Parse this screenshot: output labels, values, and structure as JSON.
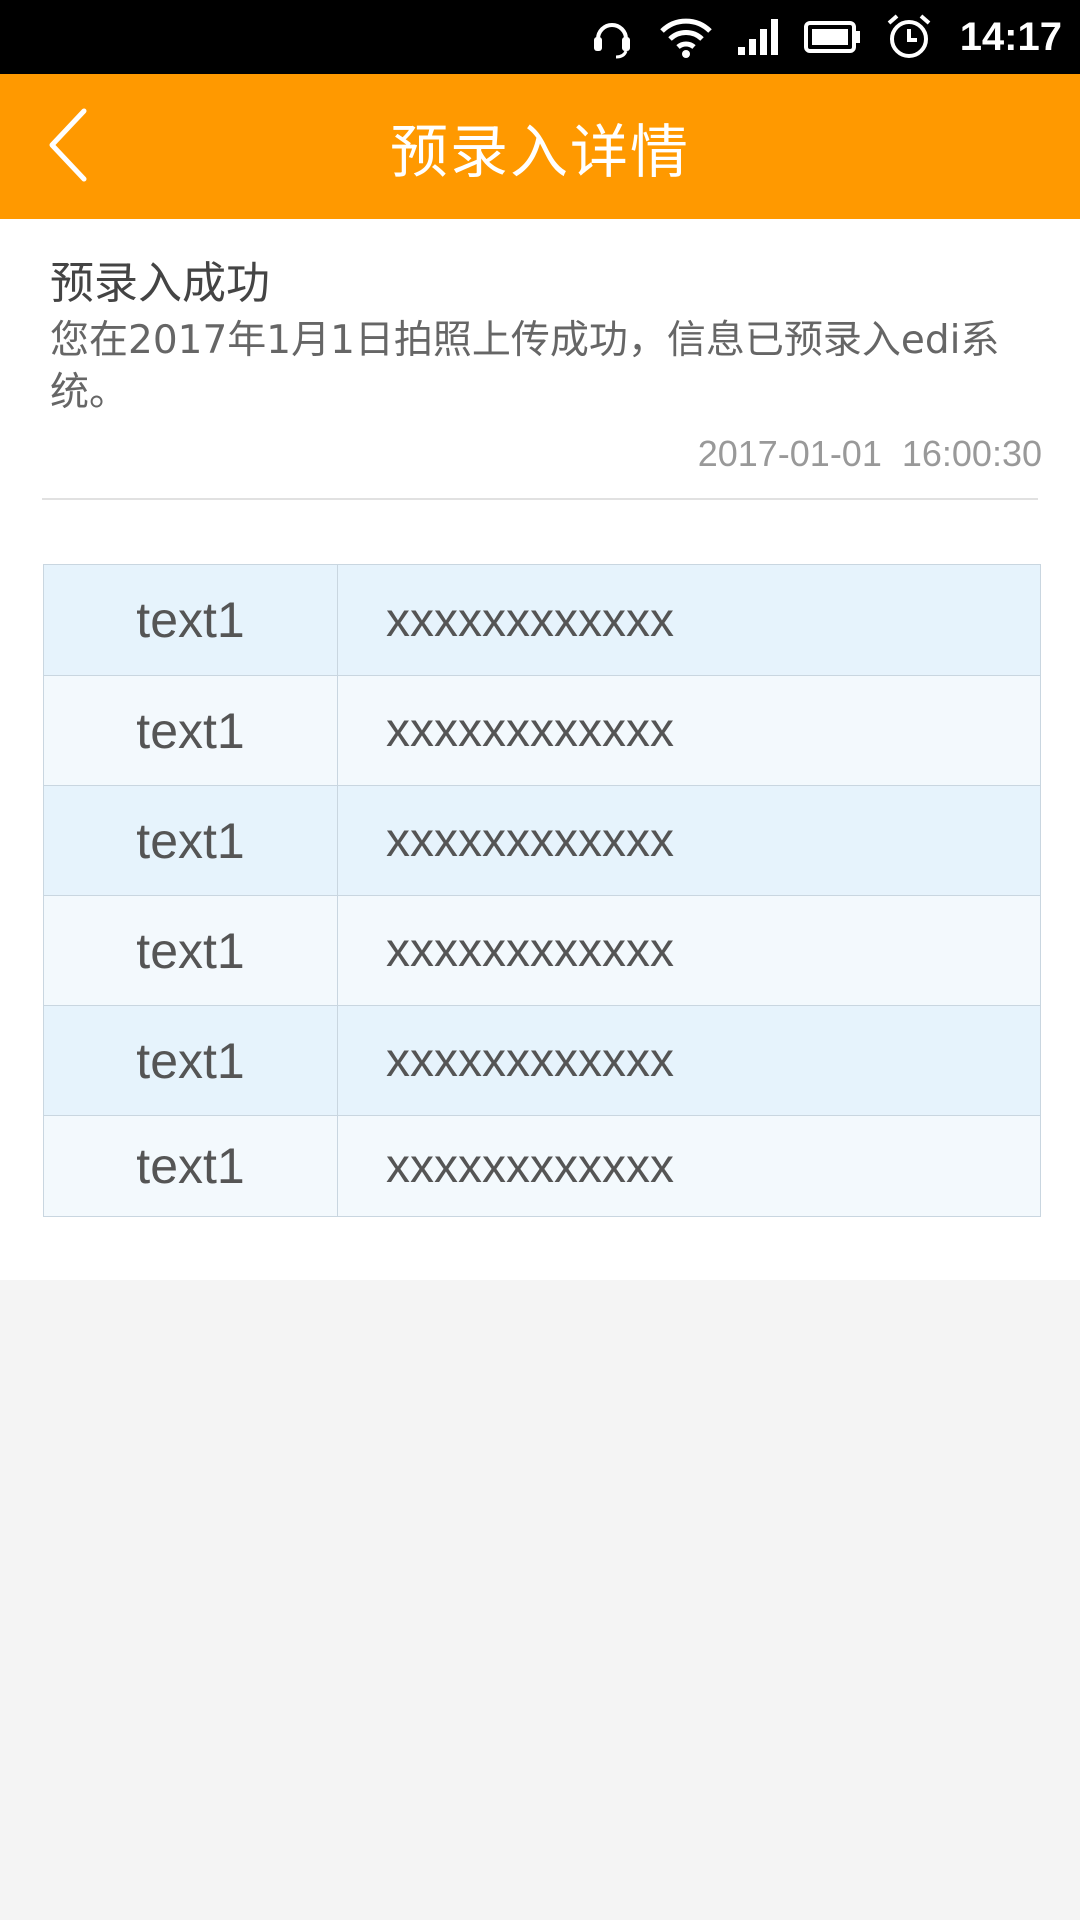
{
  "status_bar": {
    "time": "14:17",
    "icons": [
      "headset-icon",
      "wifi-icon",
      "signal-icon",
      "battery-icon",
      "alarm-icon"
    ]
  },
  "header": {
    "back_icon": "chevron-left-icon",
    "title": "预录入详情"
  },
  "message": {
    "title": "预录入成功",
    "body": "您在2017年1月1日拍照上传成功，信息已预录入edi系统。",
    "timestamp": "2017-01-01  16:00:30"
  },
  "table": {
    "rows": [
      {
        "label": "text1",
        "value": "xxxxxxxxxxxx"
      },
      {
        "label": "text1",
        "value": "xxxxxxxxxxxx"
      },
      {
        "label": "text1",
        "value": "xxxxxxxxxxxx"
      },
      {
        "label": "text1",
        "value": "xxxxxxxxxxxx"
      },
      {
        "label": "text1",
        "value": "xxxxxxxxxxxx"
      },
      {
        "label": "text1",
        "value": "xxxxxxxxxxxx"
      }
    ]
  },
  "colors": {
    "accent": "#ff9900",
    "row_odd": "#e6f3fc",
    "row_even": "#f3f9fd",
    "page_background": "#f4f4f4"
  }
}
